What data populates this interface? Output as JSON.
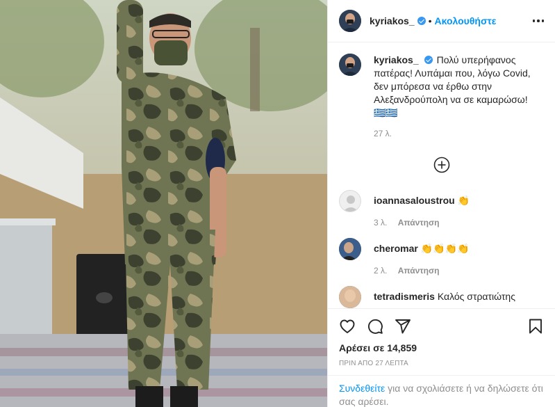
{
  "post": {
    "username": "kyriakos_",
    "dot": "•",
    "follow_label": "Ακολουθήστε"
  },
  "caption": {
    "username": "kyriakos_",
    "text": "Πολύ υπερήφανος πατέρας! Λυπάμαι που, λόγω Covid, δεν μπόρεσα να έρθω στην Αλεξανδρούπολη να σε καμαρώσω! 🇬🇷🇬🇷",
    "time": "27 λ."
  },
  "comments": [
    {
      "username": "ioannasaloustrou",
      "text": "👏",
      "time": "3 λ.",
      "reply": "Απάντηση"
    },
    {
      "username": "cheromar",
      "text": "👏👏👏👏",
      "time": "2 λ.",
      "reply": "Απάντηση"
    },
    {
      "username": "tetradismeris",
      "text": "Καλός στρατιώτης",
      "time": "",
      "reply": ""
    }
  ],
  "actions": {
    "likes": "Αρέσει σε 14,859",
    "posted": "ΠΡΙΝ ΑΠΟ 27 ΛΕΠΤΑ"
  },
  "login": {
    "link": "Συνδεθείτε",
    "text": " για να σχολιάσετε ή να δηλώσετε ότι σας αρέσει."
  },
  "icons": {
    "heart": "heart-icon",
    "comment": "comment-icon",
    "share": "share-icon",
    "save": "bookmark-icon",
    "more": "more-options-icon",
    "load": "plus-circle-icon",
    "verified": "verified-badge-icon"
  },
  "colors": {
    "accent": "#0095f6",
    "verified": "#3897f0",
    "text": "#262626",
    "muted": "#8e8e8e",
    "divider": "#efefef"
  }
}
